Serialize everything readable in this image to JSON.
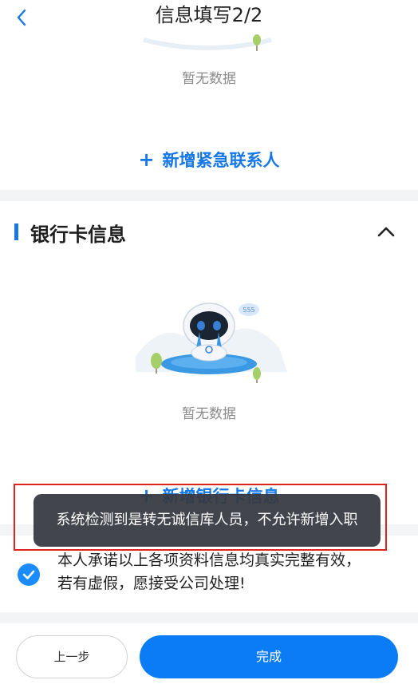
{
  "header": {
    "title": "信息填写2/2",
    "back_icon": "chevron-left-icon"
  },
  "emergency_contact": {
    "empty_text": "暂无数据",
    "add_label": "新增紧急联系人",
    "add_icon": "plus-icon"
  },
  "bank_card": {
    "title": "银行卡信息",
    "collapse_icon": "chevron-up-icon",
    "empty_text": "暂无数据",
    "add_label": "新增银行卡信息",
    "add_icon": "plus-icon",
    "empty_illustration": "crying-robot-illustration",
    "bubble_text": "555"
  },
  "toast": {
    "message": "系统检测到是转无诚信库人员，不允许新增入职"
  },
  "promise": {
    "checked": true,
    "line1": "本人承诺以上各项资料信息均真实完整有效，",
    "line2": "若有虚假，愿接受公司处理!"
  },
  "footer": {
    "prev_label": "上一步",
    "done_label": "完成"
  },
  "colors": {
    "accent": "#1677e6",
    "primary_button": "#0b7cf5",
    "toast_bg": "#373942",
    "highlight_border": "#e0231c"
  }
}
